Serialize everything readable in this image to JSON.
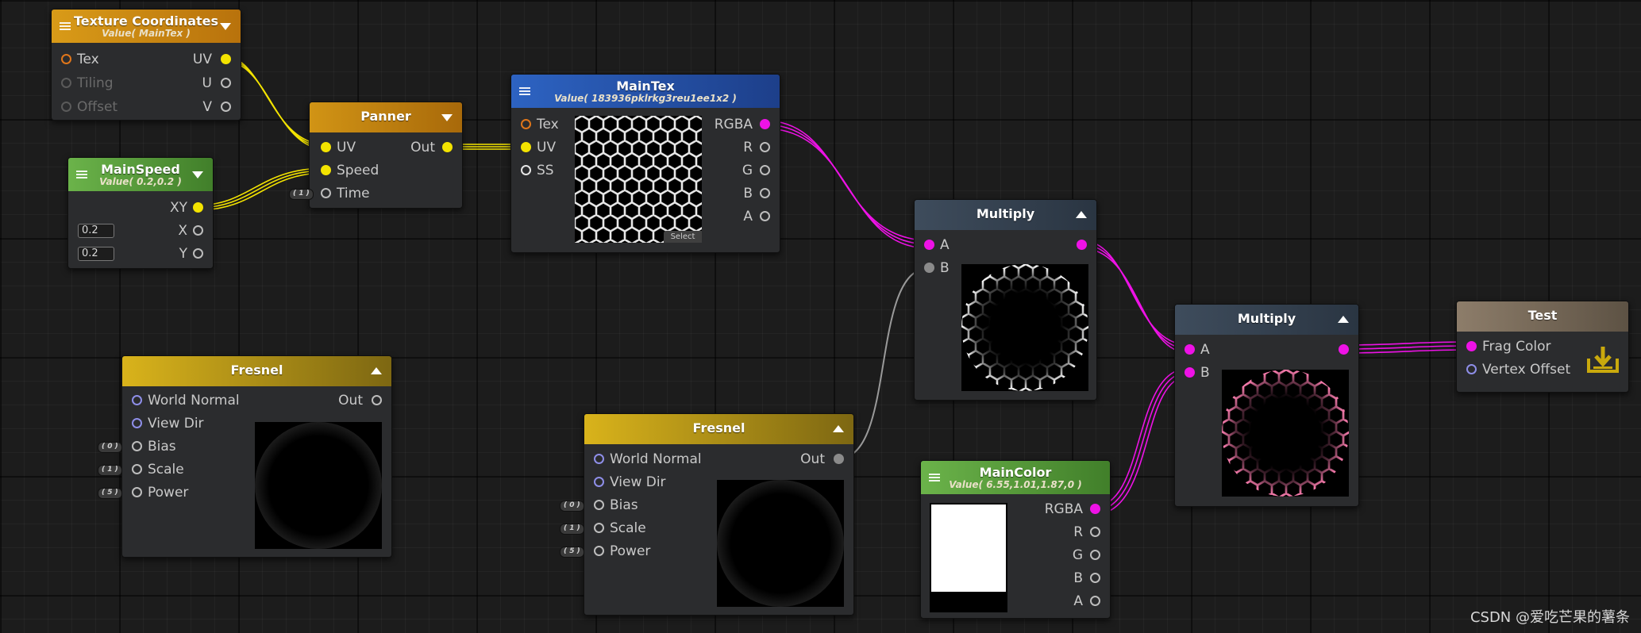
{
  "nodes": {
    "texcoord": {
      "title": "Texture Coordinates",
      "subtitle": "Value( MainTex )",
      "in": [
        "Tex",
        "Tiling",
        "Offset"
      ],
      "out": [
        "UV",
        "U",
        "V"
      ]
    },
    "mainspeed": {
      "title": "MainSpeed",
      "subtitle": "Value( 0.2,0.2 )",
      "out": [
        "XY",
        "X",
        "Y"
      ],
      "x_value": "0.2",
      "y_value": "0.2"
    },
    "panner": {
      "title": "Panner",
      "in": [
        "UV",
        "Speed",
        "Time"
      ],
      "out": "Out",
      "time_default": "( 1 )"
    },
    "maintex": {
      "title": "MainTex",
      "subtitle": "Value( 183936pklrkg3reu1ee1x2 )",
      "in": [
        "Tex",
        "UV",
        "SS"
      ],
      "out": [
        "RGBA",
        "R",
        "G",
        "B",
        "A"
      ],
      "select_label": "Select"
    },
    "fresnel1": {
      "title": "Fresnel",
      "in": [
        "World Normal",
        "View Dir",
        "Bias",
        "Scale",
        "Power"
      ],
      "out": "Out",
      "defaults": [
        "( 0 )",
        "( 1 )",
        "( 5 )"
      ]
    },
    "fresnel2": {
      "title": "Fresnel",
      "in": [
        "World Normal",
        "View Dir",
        "Bias",
        "Scale",
        "Power"
      ],
      "out": "Out",
      "defaults": [
        "( 0 )",
        "( 1 )",
        "( 5 )"
      ]
    },
    "multiply1": {
      "title": "Multiply",
      "in": [
        "A",
        "B"
      ]
    },
    "multiply2": {
      "title": "Multiply",
      "in": [
        "A",
        "B"
      ]
    },
    "maincolor": {
      "title": "MainColor",
      "subtitle": "Value( 6.55,1.01,1.87,0 )",
      "out": [
        "RGBA",
        "R",
        "G",
        "B",
        "A"
      ]
    },
    "test": {
      "title": "Test",
      "in": [
        "Frag Color",
        "Vertex Offset"
      ]
    }
  },
  "watermark": "CSDN @爱吃芒果的薯条",
  "colors": {
    "wire_uv": "#f3e300",
    "wire_color": "#ee12e6",
    "wire_float": "#9a9a9a"
  }
}
